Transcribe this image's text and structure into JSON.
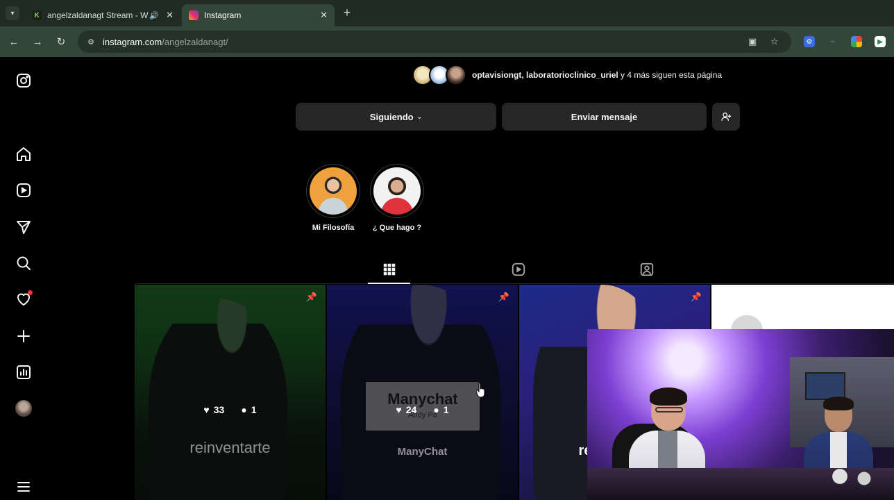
{
  "browser": {
    "tabs": [
      {
        "title": "angelzaldanagt Stream - W",
        "active": false,
        "audio": true
      },
      {
        "title": "Instagram",
        "active": true,
        "audio": false
      }
    ],
    "address": {
      "host": "instagram.com",
      "path": "/angelzaldanagt/"
    }
  },
  "sidebar": {
    "items": [
      {
        "name": "instagram-logo-icon"
      },
      {
        "name": "home-icon"
      },
      {
        "name": "reels-icon"
      },
      {
        "name": "explore-icon"
      },
      {
        "name": "search-icon"
      },
      {
        "name": "notifications-heart-icon"
      },
      {
        "name": "create-plus-icon"
      },
      {
        "name": "dashboard-icon"
      },
      {
        "name": "profile-avatar"
      },
      {
        "name": "more-menu-icon"
      }
    ]
  },
  "profile": {
    "followed_by": {
      "names": "optavisiongt, laboratorioclinico_uriel",
      "rest": " y 4 más siguen esta página"
    },
    "buttons": {
      "following": "Siguiendo",
      "message": "Enviar mensaje",
      "suggest_icon": "add-person-icon"
    },
    "highlights": [
      {
        "label": "Mi Filosofía"
      },
      {
        "label": "¿ Que hago ?"
      }
    ],
    "tabs": [
      {
        "name": "posts-grid-icon",
        "active": true
      },
      {
        "name": "reels-tab-icon",
        "active": false
      },
      {
        "name": "tagged-tab-icon",
        "active": false
      }
    ]
  },
  "posts": [
    {
      "likes": "33",
      "comments": "1",
      "overlay_text": "reinventarte",
      "pinned": true
    },
    {
      "likes": "24",
      "comments": "1",
      "overlay_title": "Manychat",
      "overlay_sub": "Andy Pa",
      "overlay_text": "ManyChat",
      "pinned": true
    },
    {
      "overlay_text": "re",
      "pinned": true
    },
    {
      "pinned": false
    }
  ],
  "colors": {
    "tab_bar": "#1f2b23",
    "toolbar": "#34463a",
    "ig_background": "#000000",
    "button_gray": "#262626",
    "notif_dot": "#ff3040"
  }
}
